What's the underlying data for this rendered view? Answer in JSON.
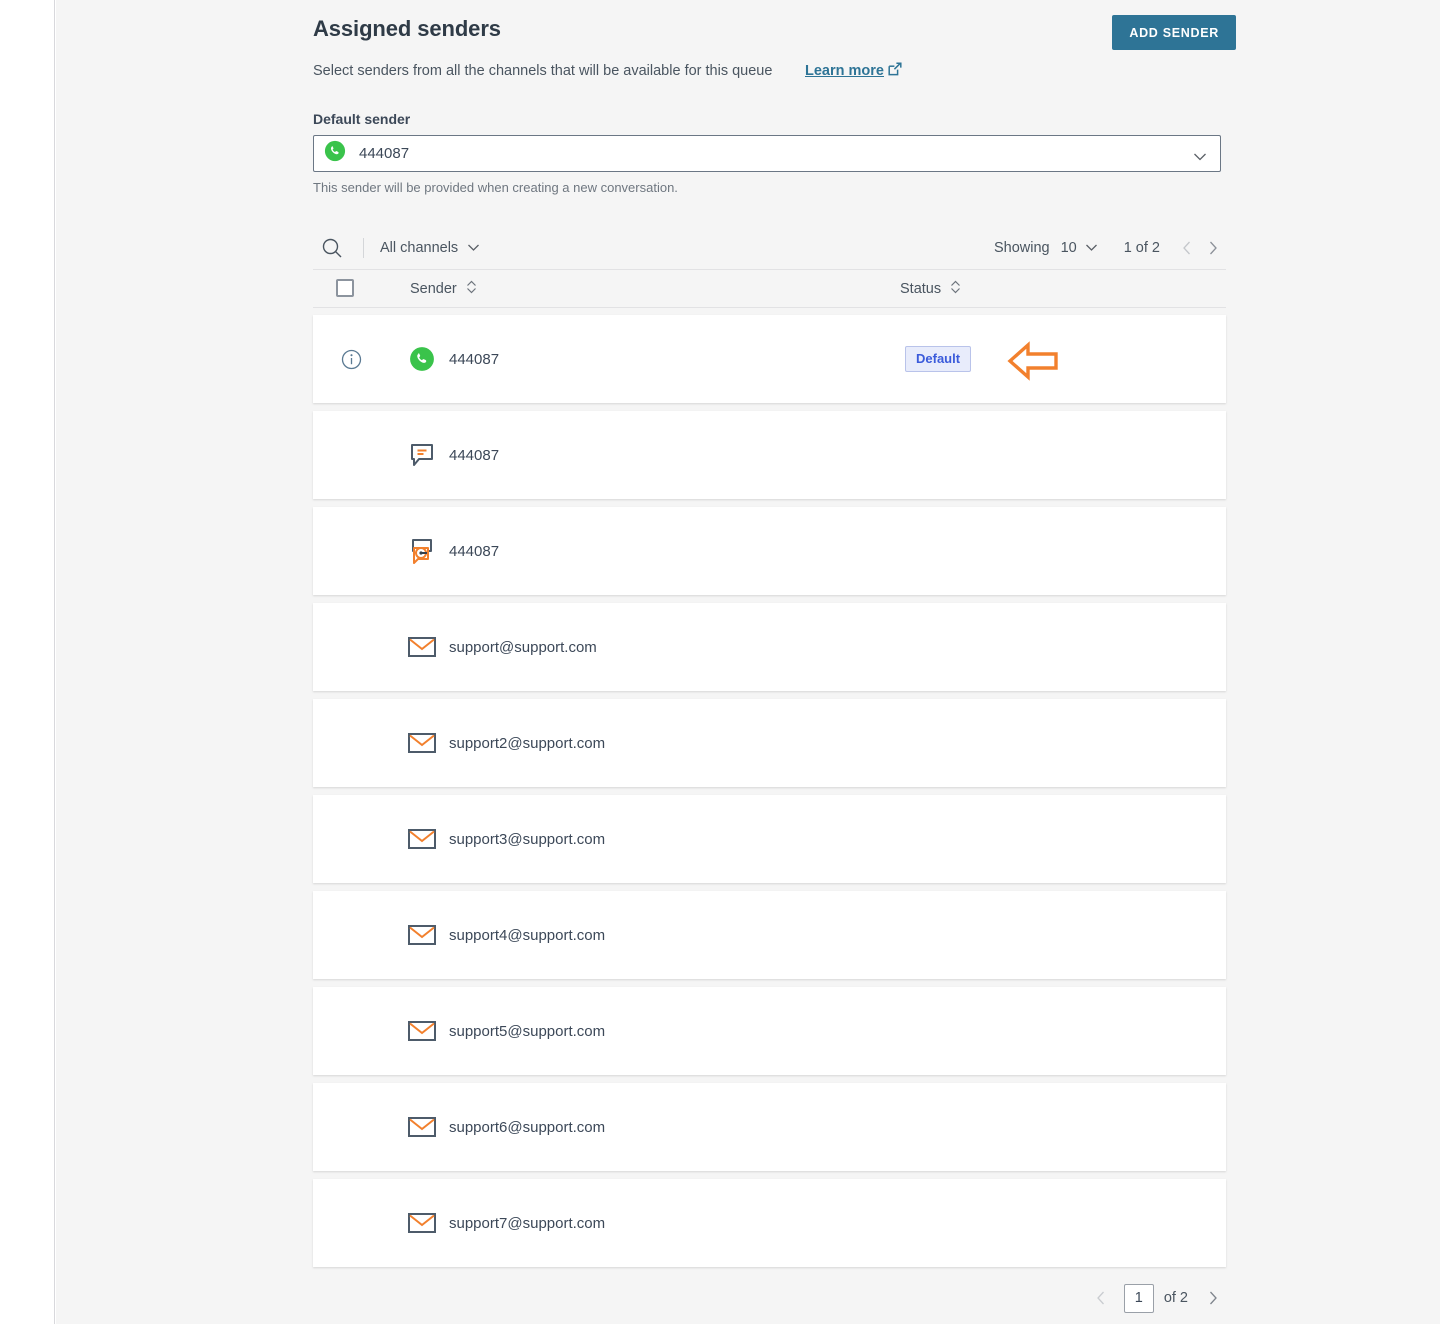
{
  "header": {
    "title": "Assigned senders",
    "add_sender_label": "ADD SENDER",
    "subtitle": "Select senders from all the channels that will be available for this queue",
    "learn_more_label": "Learn more",
    "learn_more_icon": "external-link-icon"
  },
  "default_sender": {
    "label": "Default sender",
    "value": "444087",
    "icon": "whatsapp-icon",
    "chevron_icon": "chevron-down-icon",
    "help_text": "This sender will be provided when creating a new conversation."
  },
  "toolbar": {
    "search_icon": "search-icon",
    "channel_filter_label": "All channels",
    "channel_filter_chevron": "chevron-down-icon",
    "showing_label": "Showing",
    "showing_count": "10",
    "showing_chevron": "chevron-down-icon",
    "page_indicator": "1 of 2",
    "prev_icon": "chevron-left-icon",
    "next_icon": "chevron-right-icon"
  },
  "table": {
    "select_all_checkbox": "select-all-checkbox",
    "columns": [
      {
        "label": "Sender",
        "sort_icon": "sort-arrows-icon"
      },
      {
        "label": "Status",
        "sort_icon": "sort-arrows-icon"
      }
    ],
    "rows": [
      {
        "icon": "whatsapp-icon",
        "sender": "444087",
        "status": "Default",
        "info_icon": "info-icon",
        "annotation": "left-arrow-annotation"
      },
      {
        "icon": "sms-chat-icon",
        "sender": "444087",
        "status": ""
      },
      {
        "icon": "whatsapp-business-icon",
        "sender": "444087",
        "status": ""
      },
      {
        "icon": "email-icon",
        "sender": "support@support.com",
        "status": ""
      },
      {
        "icon": "email-icon",
        "sender": "support2@support.com",
        "status": ""
      },
      {
        "icon": "email-icon",
        "sender": "support3@support.com",
        "status": ""
      },
      {
        "icon": "email-icon",
        "sender": "support4@support.com",
        "status": ""
      },
      {
        "icon": "email-icon",
        "sender": "support5@support.com",
        "status": ""
      },
      {
        "icon": "email-icon",
        "sender": "support6@support.com",
        "status": ""
      },
      {
        "icon": "email-icon",
        "sender": "support7@support.com",
        "status": ""
      }
    ]
  },
  "pagination": {
    "prev_icon": "chevron-left-icon",
    "current_page": "1",
    "of_label": "of 2",
    "next_icon": "chevron-right-icon"
  },
  "colors": {
    "accent": "#2e7496",
    "brand_orange": "#f2802d",
    "badge_text": "#3b5bdb",
    "badge_bg": "#e8ecfb",
    "whatsapp_green": "#3ac34b",
    "icon_slate": "#4d5b6a"
  }
}
